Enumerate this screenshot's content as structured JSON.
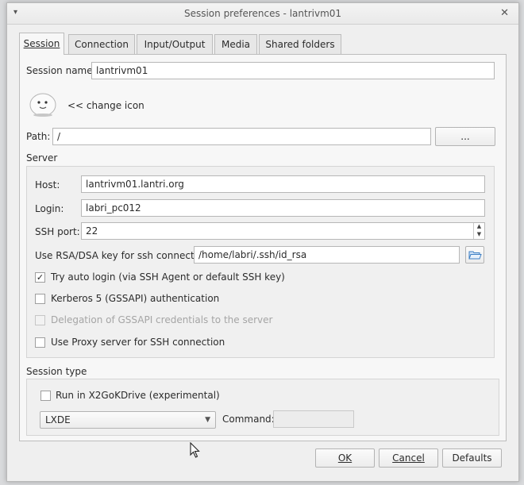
{
  "window": {
    "title": "Session preferences - lantrivm01",
    "menu_glyph": "▾",
    "close_glyph": "✕"
  },
  "tabs": [
    {
      "label": "Session",
      "active": true
    },
    {
      "label": "Connection",
      "active": false
    },
    {
      "label": "Input/Output",
      "active": false
    },
    {
      "label": "Media",
      "active": false
    },
    {
      "label": "Shared folders",
      "active": false
    }
  ],
  "session": {
    "name_label": "Session name:",
    "name_value": "lantrivm01",
    "change_icon_label": "<< change icon",
    "path_label": "Path:",
    "path_value": "/",
    "browse_label": "..."
  },
  "server": {
    "section_label": "Server",
    "host_label": "Host:",
    "host_value": "lantrivm01.lantri.org",
    "login_label": "Login:",
    "login_value": "labri_pc012",
    "ssh_port_label": "SSH port:",
    "ssh_port_value": "22",
    "rsa_label": "Use RSA/DSA key for ssh connection:",
    "rsa_value": "/home/labri/.ssh/id_rsa",
    "auto_login_label": "Try auto login (via SSH Agent or default SSH key)",
    "auto_login_checked": true,
    "kerberos_label": "Kerberos 5 (GSSAPI) authentication",
    "kerberos_checked": false,
    "delegation_label": "Delegation of GSSAPI credentials to the server",
    "delegation_checked": false,
    "proxy_label": "Use Proxy server for SSH connection",
    "proxy_checked": false
  },
  "session_type": {
    "section_label": "Session type",
    "x2gokdrive_label": "Run in X2GoKDrive (experimental)",
    "x2gokdrive_checked": false,
    "type_value": "LXDE",
    "command_label": "Command:",
    "command_value": ""
  },
  "buttons": {
    "ok": "OK",
    "cancel": "Cancel",
    "defaults": "Defaults"
  }
}
